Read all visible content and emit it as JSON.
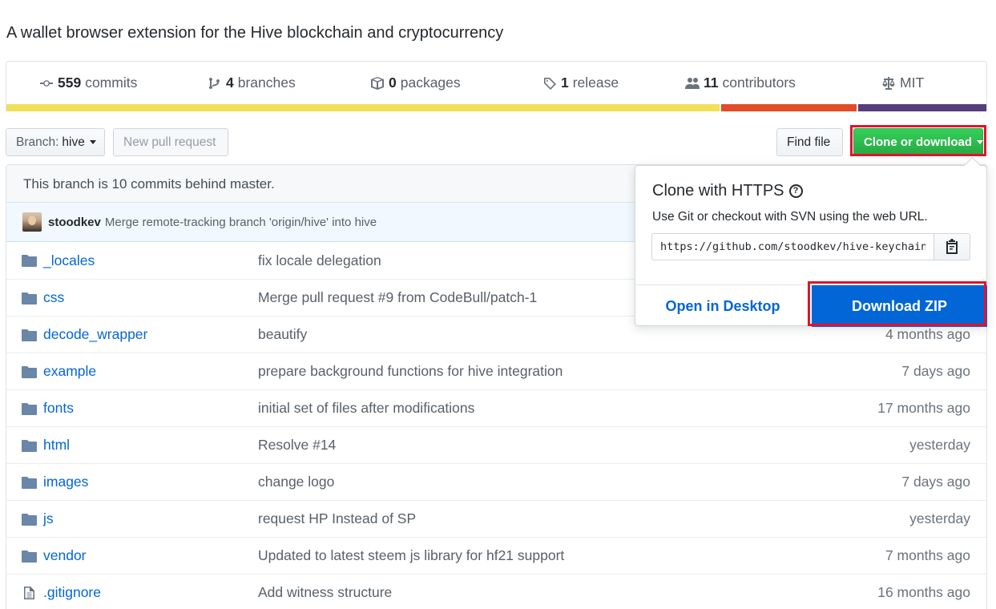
{
  "repo": {
    "description": "A wallet browser extension for the Hive blockchain and cryptocurrency"
  },
  "summary": [
    {
      "icon": "commits-icon",
      "count": "559",
      "label": "commits"
    },
    {
      "icon": "branch-icon",
      "count": "4",
      "label": "branches"
    },
    {
      "icon": "package-icon",
      "count": "0",
      "label": "packages"
    },
    {
      "icon": "tag-icon",
      "count": "1",
      "label": "release"
    },
    {
      "icon": "people-icon",
      "count": "11",
      "label": "contributors"
    },
    {
      "icon": "law-icon",
      "count": "",
      "label": "MIT"
    }
  ],
  "language_bar": {
    "colors": [
      "#f1e05a",
      "#e34c26",
      "#563d7c"
    ],
    "fractions": [
      0.73,
      0.139,
      0.131
    ]
  },
  "toolbar": {
    "branch_prefix": "Branch:",
    "branch_name": "hive",
    "new_pr": "New pull request",
    "find_file": "Find file",
    "clone": "Clone or download"
  },
  "branch_status": "This branch is 10 commits behind master.",
  "last_commit": {
    "author": "stoodkev",
    "message": "Merge remote-tracking branch 'origin/hive' into hive"
  },
  "files": [
    {
      "type": "dir",
      "name": "_locales",
      "message": "fix locale delegation",
      "age": ""
    },
    {
      "type": "dir",
      "name": "css",
      "message": "Merge pull request #9 from CodeBull/patch-1",
      "age": ""
    },
    {
      "type": "dir",
      "name": "decode_wrapper",
      "message": "beautify",
      "age": "4 months ago"
    },
    {
      "type": "dir",
      "name": "example",
      "message": "prepare background functions for hive integration",
      "age": "7 days ago"
    },
    {
      "type": "dir",
      "name": "fonts",
      "message": "initial set of files after modifications",
      "age": "17 months ago"
    },
    {
      "type": "dir",
      "name": "html",
      "message": "Resolve #14",
      "age": "yesterday"
    },
    {
      "type": "dir",
      "name": "images",
      "message": "change logo",
      "age": "7 days ago"
    },
    {
      "type": "dir",
      "name": "js",
      "message": "request HP Instead of SP",
      "age": "yesterday"
    },
    {
      "type": "dir",
      "name": "vendor",
      "message": "Updated to latest steem js library for hf21 support",
      "age": "7 months ago"
    },
    {
      "type": "file",
      "name": ".gitignore",
      "message": "Add witness structure",
      "age": "16 months ago"
    }
  ],
  "clone_dropdown": {
    "title": "Clone with HTTPS",
    "subtitle": "Use Git or checkout with SVN using the web URL.",
    "url": "https://github.com/stoodkev/hive-keychain.git",
    "open_desktop": "Open in Desktop",
    "download_zip": "Download ZIP"
  },
  "colors": {
    "link": "#0366d6",
    "primary_green": "#28a745",
    "highlight_red": "#e0132b"
  }
}
